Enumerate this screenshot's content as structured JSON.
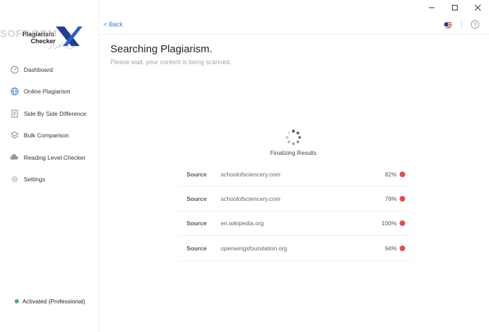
{
  "window": {
    "minimize_icon": "minimize-icon",
    "maximize_icon": "maximize-icon",
    "close_icon": "close-icon"
  },
  "app": {
    "logo_line1": "Plagiarism",
    "logo_line2": "Checker",
    "logo_mark": "X",
    "watermark": "SOFT.COM",
    "watermark_line2": "نرم افزار"
  },
  "sidebar": {
    "items": [
      {
        "label": "Dashboard",
        "icon": "gauge-icon"
      },
      {
        "label": "Online Plagiarism",
        "icon": "globe-icon"
      },
      {
        "label": "Side By Side Difference",
        "icon": "document-icon"
      },
      {
        "label": "Bulk Comparison",
        "icon": "layers-icon"
      },
      {
        "label": "Reading Level Checker",
        "icon": "cloud-icon"
      },
      {
        "label": "Settings",
        "icon": "gear-icon"
      }
    ],
    "status": "Activated (Professional)",
    "status_color": "#3cb371"
  },
  "topbar": {
    "back_label": "< Back",
    "help_label": "?"
  },
  "main": {
    "title": "Searching Plagiarism.",
    "subtitle": "Please wait, your content is being scanned.",
    "loading_label": "Finalizing Results"
  },
  "results": [
    {
      "label": "Source",
      "url": "schoolofsciencery.com",
      "percent": "82%"
    },
    {
      "label": "Source",
      "url": "schoolofsciencery.com",
      "percent": "79%"
    },
    {
      "label": "Source",
      "url": "en.wikipedia.org",
      "percent": "100%"
    },
    {
      "label": "Source",
      "url": "openwingsfoundation.org",
      "percent": "94%"
    }
  ],
  "colors": {
    "accent": "#3a7bd5",
    "match_dot": "#e74c4c"
  }
}
